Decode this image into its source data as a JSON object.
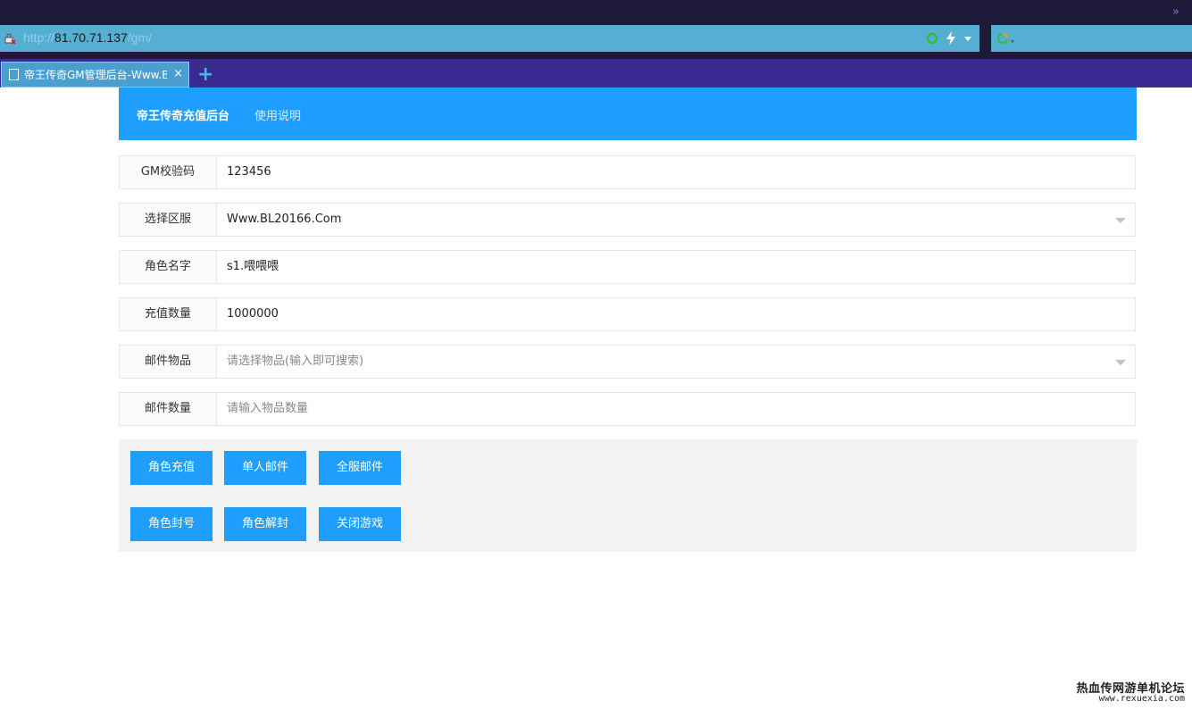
{
  "browser": {
    "url_scheme": "http://",
    "url_host": "81.70.71.137",
    "url_path": "/gm/",
    "tab_title": "帝王传奇GM管理后台-Www.BL",
    "tab_close": "×",
    "new_tab": "+",
    "overflow_chevron": "»"
  },
  "header": {
    "brand": "帝王传奇充值后台",
    "help_link": "使用说明"
  },
  "form": {
    "gm_code": {
      "label": "GM校验码",
      "value": "123456"
    },
    "server": {
      "label": "选择区服",
      "value": "Www.BL20166.Com"
    },
    "role_name": {
      "label": "角色名字",
      "value": "s1.喂喂喂"
    },
    "recharge_amount": {
      "label": "充值数量",
      "value": "1000000"
    },
    "mail_item": {
      "label": "邮件物品",
      "placeholder": "请选择物品(输入即可搜索)"
    },
    "mail_qty": {
      "label": "邮件数量",
      "placeholder": "请输入物品数量"
    }
  },
  "buttons": {
    "role_recharge": "角色充值",
    "single_mail": "单人邮件",
    "server_mail": "全服邮件",
    "ban_role": "角色封号",
    "unban_role": "角色解封",
    "close_game": "关闭游戏"
  },
  "watermark": {
    "zh": "热血传网游单机论坛",
    "en": "www.rexuexia.com"
  },
  "colors": {
    "primary": "#1e9fff",
    "tab_bar": "#3a2a92",
    "address_bar": "#57aed3",
    "panel_bg": "#f2f2f2"
  }
}
